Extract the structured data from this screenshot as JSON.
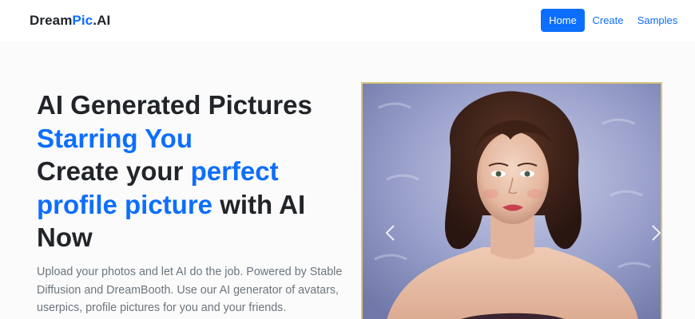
{
  "brand": {
    "part1": "Dream",
    "part2": "Pic",
    "part3": ".AI"
  },
  "nav": {
    "home": "Home",
    "create": "Create",
    "samples": "Samples"
  },
  "hero": {
    "line1": "AI Generated Pictures",
    "line2_blue": "Starring You",
    "line3_a": "Create your ",
    "line3_blue": "perfect",
    "line4_blue": "profile picture",
    "line4_b": " with AI",
    "line5": "Now",
    "description": "Upload your photos and let AI do the job. Powered by Stable Diffusion and DreamBooth. Use our AI generator of avatars, userpics, profile pictures for you and your friends."
  },
  "colors": {
    "primary": "#0d6efd",
    "text_dark": "#212529",
    "text_muted": "#6c757d",
    "image_border": "#d8c27a"
  },
  "icons": {
    "carousel_prev": "chevron-left-icon",
    "carousel_next": "chevron-right-icon"
  }
}
